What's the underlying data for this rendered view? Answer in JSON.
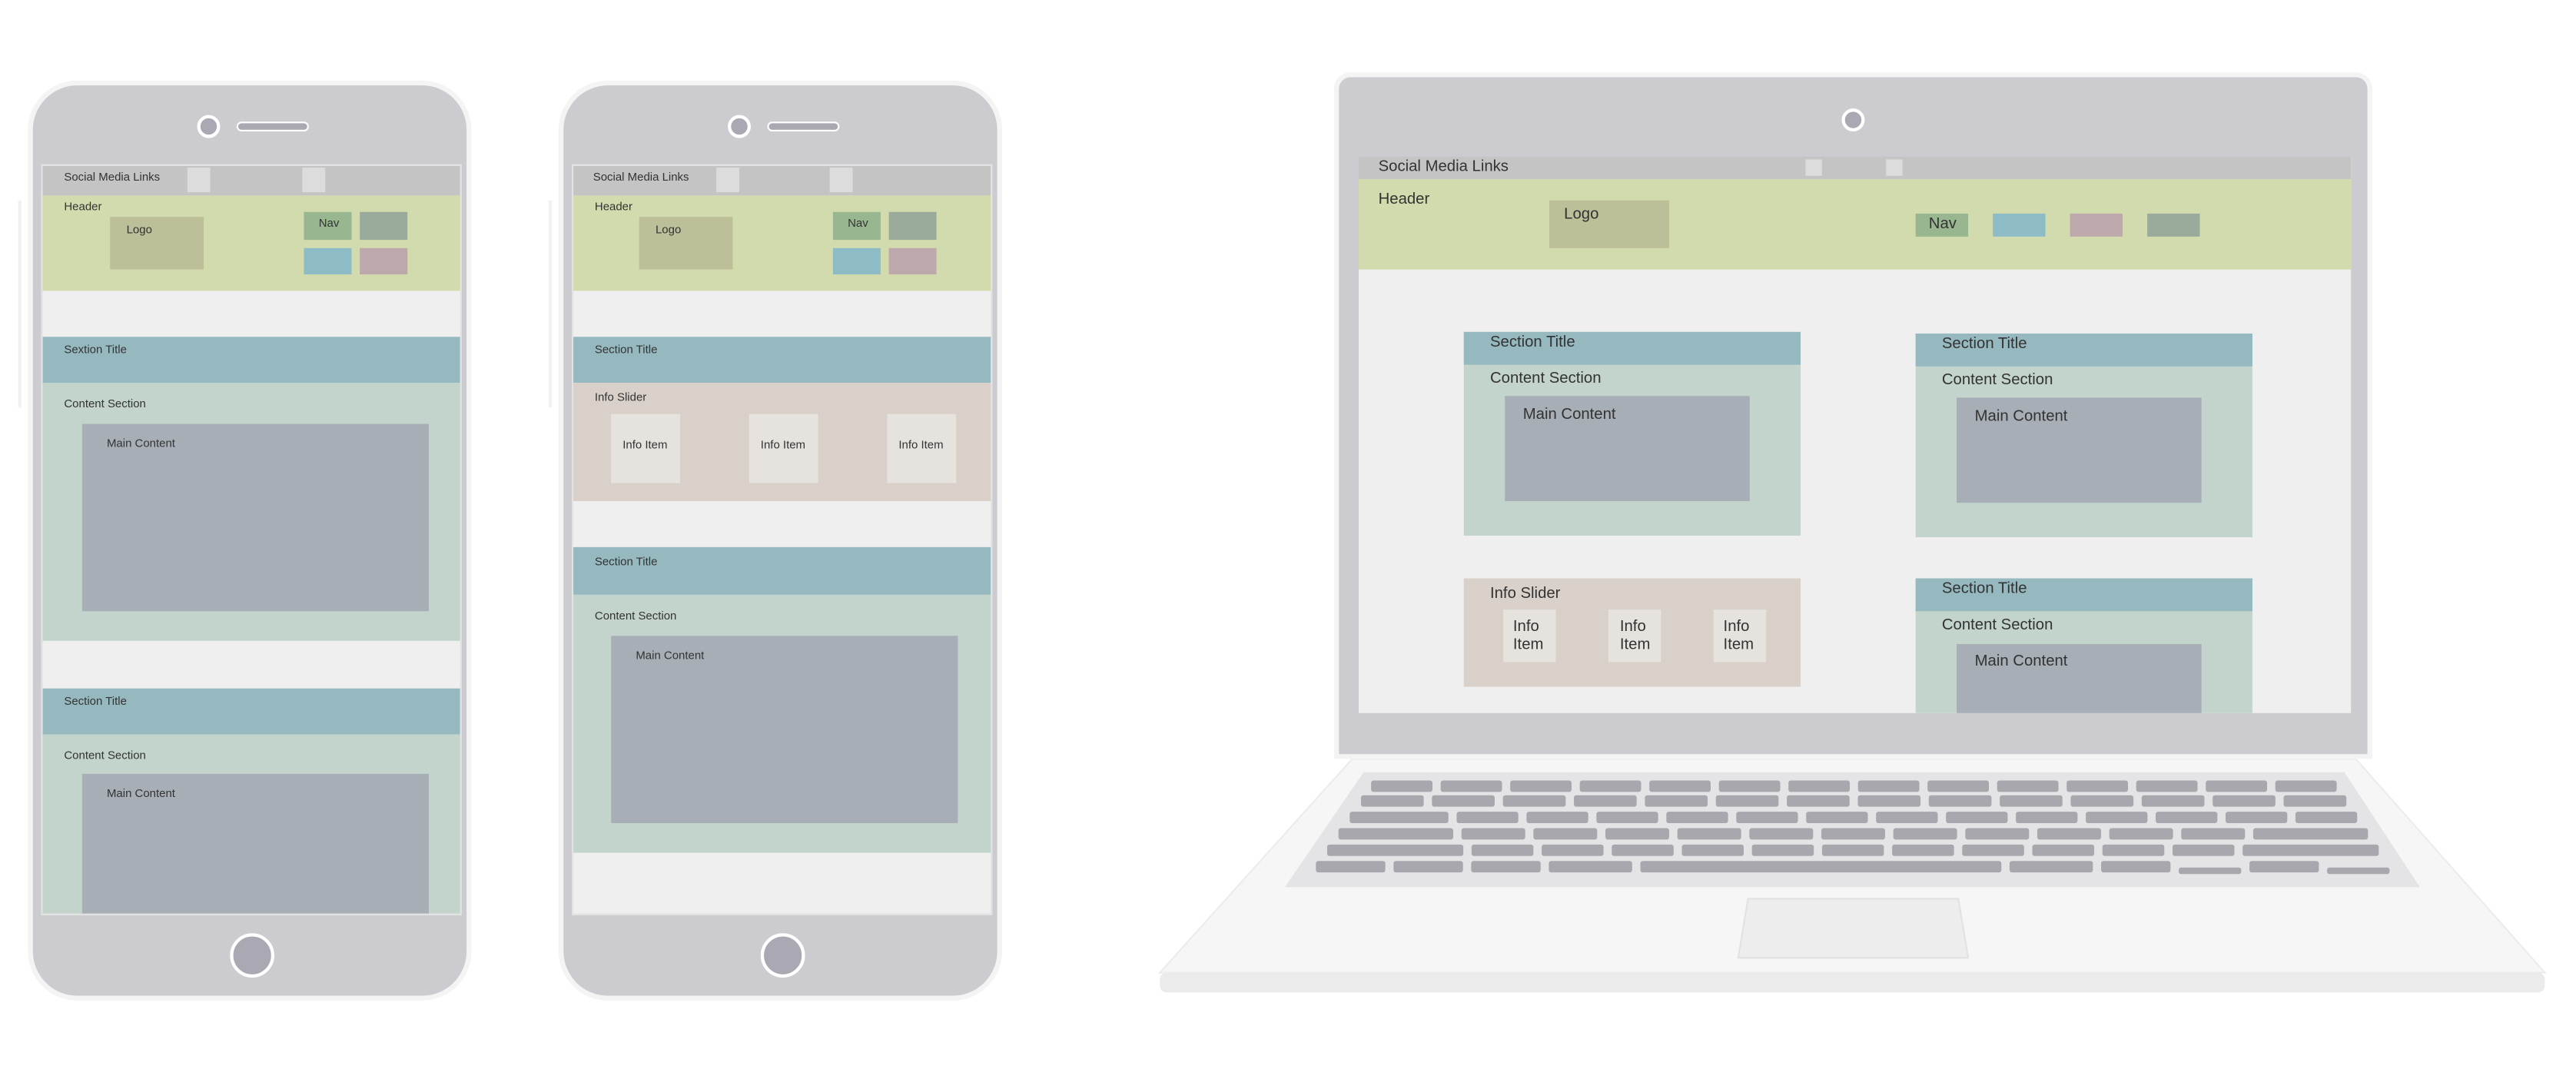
{
  "colors": {
    "device_bezel": "#cccbd0",
    "social_bar": "#c4c4c4",
    "header": "#d2dbad",
    "logo": "#bdbf98",
    "nav_green": "#98b690",
    "nav_gray": "#9aab9b",
    "nav_blue": "#8dbcc6",
    "nav_pink": "#bda8ab",
    "section_title": "#95b9bf",
    "content_section": "#c2d4cb",
    "main_content": "#a7aeb6",
    "info_slider": "#d9d1c9",
    "info_item": "#e6e2de",
    "page_bg": "#efefef",
    "key": "#a8a7ad"
  },
  "phone_1": {
    "social": "Social Media Links",
    "header": "Header",
    "logo": "Logo",
    "nav": "Nav",
    "sections": [
      {
        "title": "Sextion Title",
        "content": "Content Section",
        "main": "Main Content"
      },
      {
        "title": "Section Title",
        "content": "Content Section",
        "main": "Main Content"
      }
    ]
  },
  "phone_2": {
    "social": "Social Media Links",
    "header": "Header",
    "logo": "Logo",
    "nav": "Nav",
    "section_1_title": "Section Title",
    "slider": {
      "label": "Info Slider",
      "items": [
        "Info Item",
        "Info Item",
        "Info Item"
      ]
    },
    "section_2": {
      "title": "Section Title",
      "content": "Content Section",
      "main": "Main Content"
    }
  },
  "laptop": {
    "social": "Social Media Links",
    "header": "Header",
    "logo": "Logo",
    "nav": "Nav",
    "cards": [
      {
        "title": "Section Title",
        "content": "Content Section",
        "main": "Main Content"
      },
      {
        "title": "Section Title",
        "content": "Content Section",
        "main": "Main Content"
      },
      {
        "title": "Section Title",
        "content": "Content Section",
        "main": "Main Content"
      }
    ],
    "slider": {
      "label": "Info Slider",
      "items": [
        "Info\nItem",
        "Info\nItem",
        "Info\nItem"
      ]
    }
  }
}
